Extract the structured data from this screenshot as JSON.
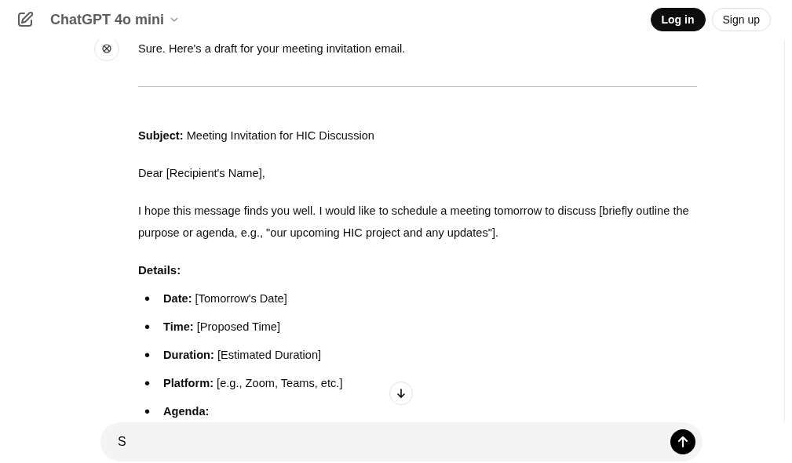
{
  "header": {
    "model": "ChatGPT 4o mini",
    "login": "Log in",
    "signup": "Sign up"
  },
  "message": {
    "intro": "Sure. Here's a draft for your meeting invitation email.",
    "blocks": [
      {
        "kind": "para",
        "text": "**Subject:** Meeting Invitation for HIC Discussion"
      },
      {
        "kind": "para",
        "text": "Dear [Recipient's Name],"
      },
      {
        "kind": "para",
        "text": "I hope this message finds you well. I would like to schedule a meeting tomorrow to discuss [briefly outline the purpose or agenda, e.g., \"our upcoming HIC project and any updates\"]."
      },
      {
        "kind": "heading",
        "text": "Details:"
      },
      {
        "kind": "list",
        "items": [
          {
            "marker": "•",
            "text": "**Date:** [Tomorrow's Date]"
          },
          {
            "marker": "•",
            "text": "**Time:** [Proposed Time]"
          },
          {
            "marker": "•",
            "text": "**Duration:** [Estimated Duration]"
          },
          {
            "marker": "•",
            "text": "**Platform:** [e.g., Zoom, Teams, etc.]"
          },
          {
            "marker": "•",
            "text": "**Agenda:**"
          }
        ]
      }
    ]
  },
  "composer": {
    "value": "S"
  }
}
